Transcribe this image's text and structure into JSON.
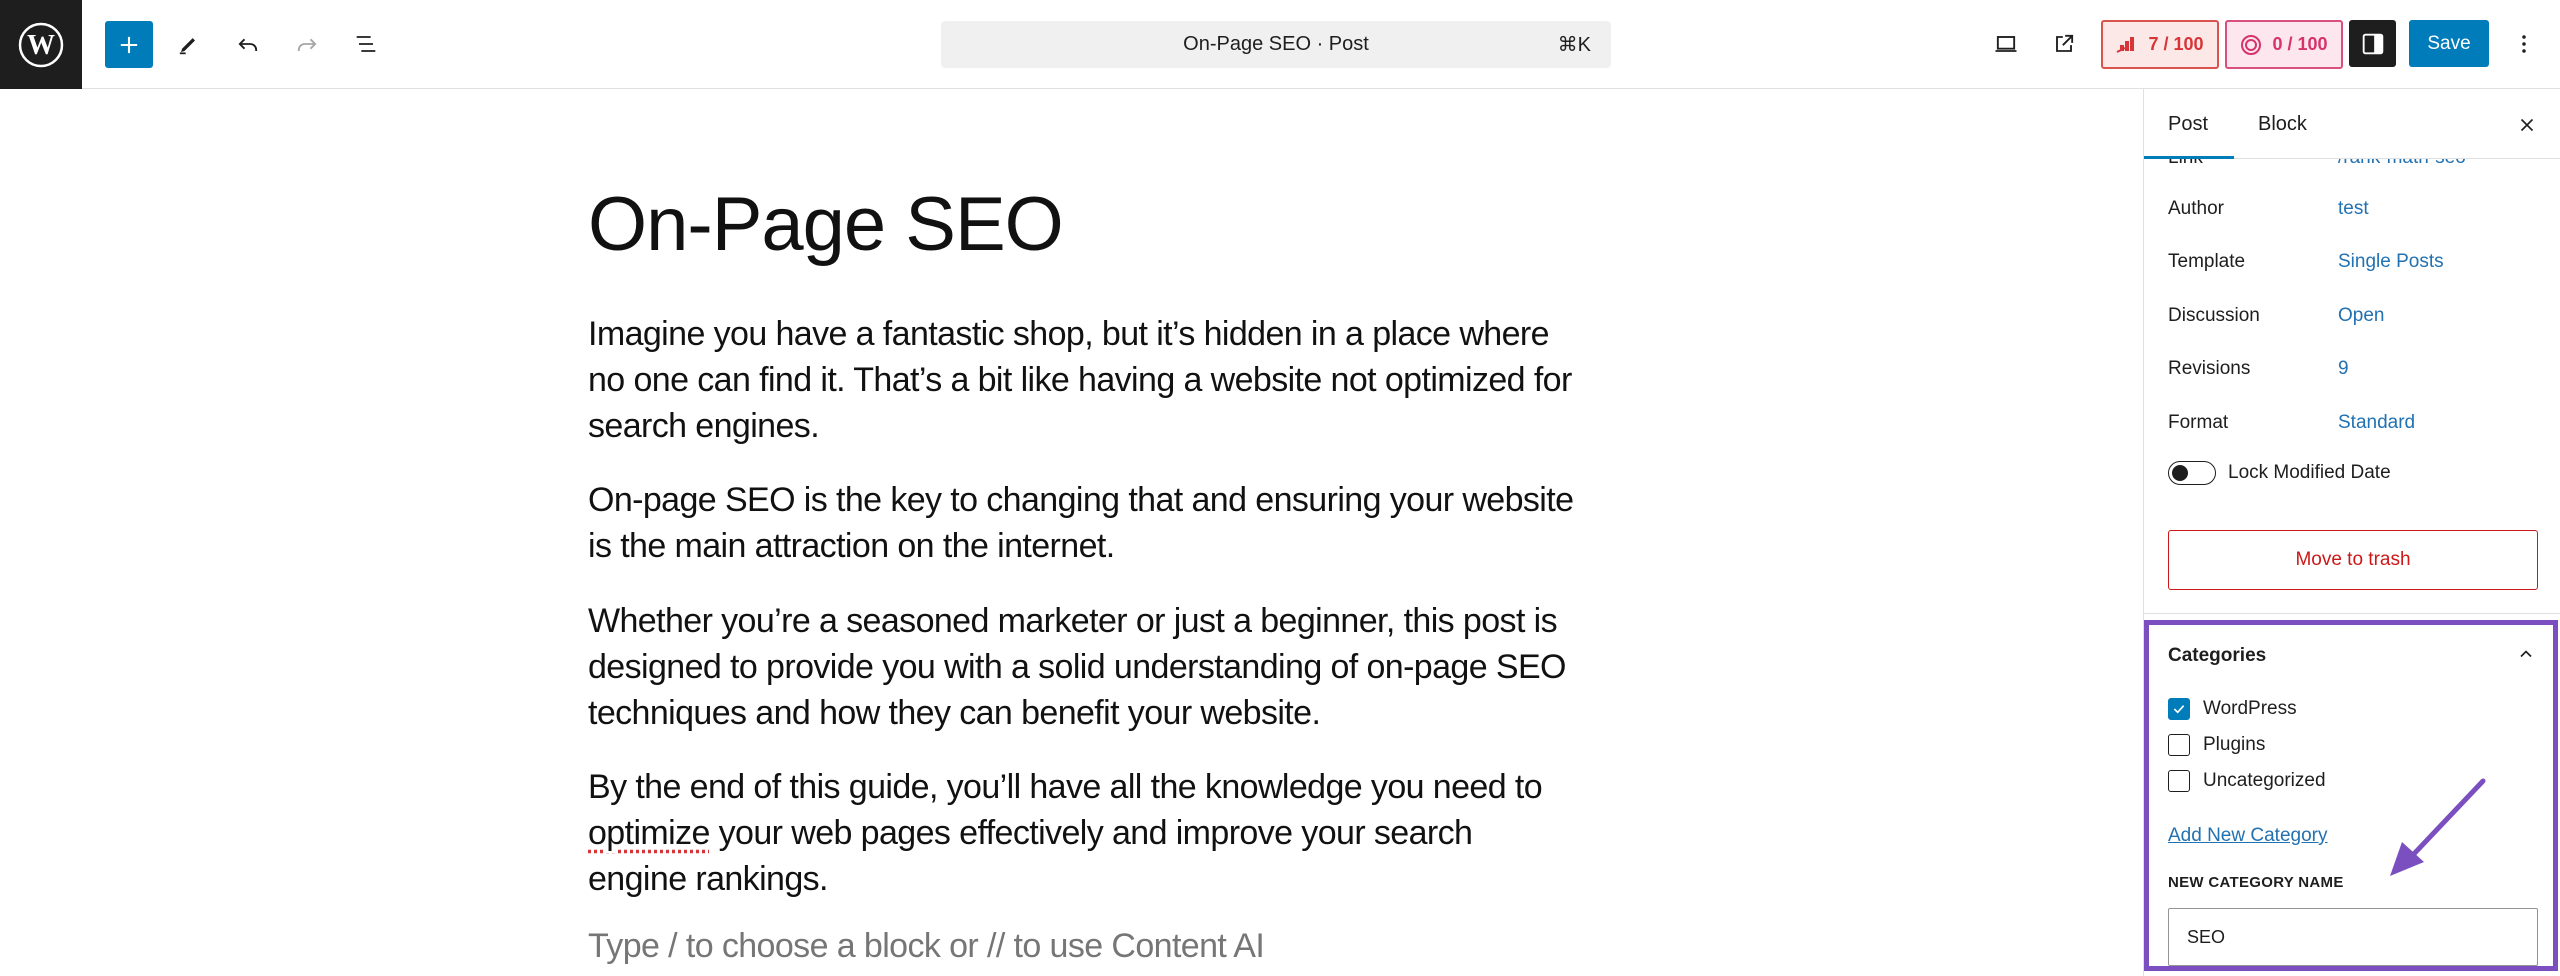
{
  "header": {
    "command_bar": {
      "title": "On-Page SEO · Post",
      "shortcut": "⌘K"
    },
    "seo_score": "7 / 100",
    "content_ai_score": "0 / 100",
    "save_label": "Save",
    "icons": {
      "logo": "wordpress-logo-icon",
      "add": "plus-icon",
      "tools": "pencil-icon",
      "undo": "undo-icon",
      "redo": "redo-icon",
      "outline": "list-view-icon",
      "view": "laptop-icon",
      "preview": "external-link-icon",
      "settings": "sidebar-toggle-icon",
      "more": "vertical-ellipsis-icon"
    }
  },
  "editor": {
    "title": "On-Page SEO",
    "paragraphs": [
      "Imagine you have a fantastic shop, but it’s hidden in a place where no one can find it. That’s a bit like having a website not optimized for search engines.",
      "On-page SEO is the key to changing that and ensuring your website is the main attraction on the internet.",
      "Whether you’re a seasoned marketer or just a beginner, this post is designed to provide you with a solid understanding of on-page SEO techniques and how they can benefit your website."
    ],
    "last_paragraph": {
      "before": "By the end of this guide, you’ll have all the knowledge you need to ",
      "misspelled": "optimize",
      "after": " your web pages effectively and improve your search engine rankings."
    },
    "placeholder": "Type / to choose a block or // to use Content AI"
  },
  "sidebar": {
    "tabs": [
      {
        "label": "Post",
        "active": true
      },
      {
        "label": "Block",
        "active": false
      }
    ],
    "summary": [
      {
        "label": "Link",
        "value": "/rank-math-seo"
      },
      {
        "label": "Author",
        "value": "test"
      },
      {
        "label": "Template",
        "value": "Single Posts"
      },
      {
        "label": "Discussion",
        "value": "Open"
      },
      {
        "label": "Revisions",
        "value": "9"
      },
      {
        "label": "Format",
        "value": "Standard"
      }
    ],
    "lock_modified_date": {
      "label": "Lock Modified Date",
      "enabled": false
    },
    "trash_label": "Move to trash",
    "categories": {
      "title": "Categories",
      "expanded": true,
      "items": [
        {
          "label": "WordPress",
          "checked": true
        },
        {
          "label": "Plugins",
          "checked": false
        },
        {
          "label": "Uncategorized",
          "checked": false
        }
      ],
      "add_new_label": "Add New Category",
      "new_name_label": "NEW CATEGORY NAME",
      "new_name_value": "SEO"
    }
  },
  "colors": {
    "accent": "#007cba",
    "link": "#2271b1",
    "danger": "#cc1818",
    "annotation": "#7b4fc0"
  }
}
